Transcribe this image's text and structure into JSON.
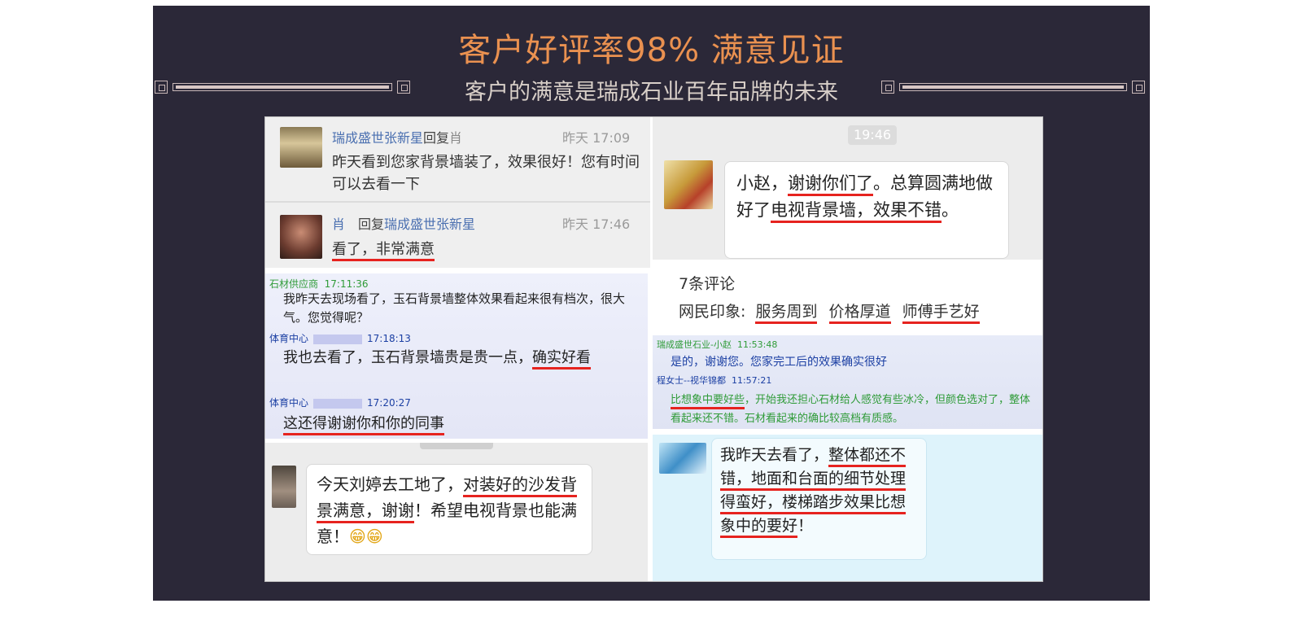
{
  "header": {
    "title": "客户好评率98%  满意见证",
    "subtitle": "客户的满意是瑞成石业百年品牌的未来"
  },
  "reviews": {
    "p1": {
      "msg1": {
        "name": "瑞成盛世张新星",
        "reply_word": "回复",
        "to": "肖",
        "time": "昨天 17:09",
        "text": "昨天看到您家背景墙装了，效果很好！您有时间可以去看一下"
      },
      "msg2": {
        "name": "肖",
        "reply_word": "回复",
        "to": "瑞成盛世张新星",
        "time": "昨天 17:46",
        "text": "看了，非常满意"
      }
    },
    "p2": {
      "time": "19:46",
      "text_a": "小赵，",
      "text_b": "谢谢你们了",
      "text_c": "。总算圆满地做好了",
      "text_d": "电视背景墙，效果不错",
      "text_e": "。"
    },
    "p3": {
      "m1_name": "石材供应商",
      "m1_time": "17:11:36",
      "m1_text": "我昨天去现场看了，玉石背景墙整体效果看起来很有档次，很大气。您觉得呢？",
      "m2_name": "体育中心",
      "m2_time": "17:18:13",
      "m2_text_a": "我也去看了，玉石背景墙贵是贵一点，",
      "m2_text_b": "确实好看",
      "m3_name": "体育中心",
      "m3_time": "17:20:27",
      "m3_text": "这还得谢谢你和你的同事"
    },
    "p4": {
      "count": "7条评论",
      "impression_label": "网民印象:",
      "tags": [
        "服务周到",
        "价格厚道",
        "师傅手艺好"
      ]
    },
    "p5": {
      "m1_name": "瑞成盛世石业-小赵",
      "m1_time": "11:53:48",
      "m1_text": "是的，谢谢您。您家完工后的效果确实很好",
      "m2_name": "程女士--视华锦都",
      "m2_time": "11:57:21",
      "m2_text_a": "比想象中要好些",
      "m2_text_b": "，开始我还担心石材给人感觉有些冰冷，但颜色选对了，整体看起来还不错。石材看起来的确比较高档有质感。"
    },
    "p6": {
      "text_a": "今天刘婷去工地了，",
      "text_b": "对装好的沙发背景满意，谢谢",
      "text_c": "！希望电视背景也能满意！",
      "emoji": "😁😁"
    },
    "p7": {
      "text_a": "我昨天去看了，",
      "text_b": "整体都还不错，地面和台面的细节处理得蛮好，楼梯踏步效果比想象中的要好",
      "text_c": "！"
    }
  },
  "colors": {
    "banner_bg": "#2b2838",
    "title": "#ea9150",
    "underline": "#e6231f",
    "qq_green": "#2f9b38",
    "qq_blue": "#1b3fa3"
  }
}
